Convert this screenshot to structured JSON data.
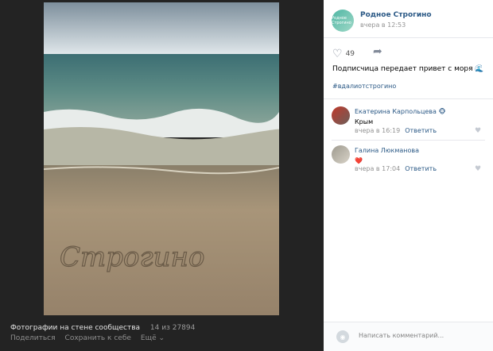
{
  "photo_viewer": {
    "caption": "Фотографии на стене сообщества",
    "counter": "14 из 27894",
    "actions": [
      "Поделиться",
      "Сохранить к себе",
      "Ещё"
    ]
  },
  "post": {
    "group_name": "Родное Строгино",
    "group_avatar_text": "Родное Строгино",
    "time": "вчера в 12:53",
    "likes": "49",
    "text": "Подписчица передает привет с моря 🌊",
    "hashtag": "#вдалиотстрогино",
    "photo_sand_text": "Строгино"
  },
  "comments": [
    {
      "name": "Екатерина Карпольцева 🐵",
      "text": "Крым",
      "time": "вчера в 16:19",
      "reply": "Ответить"
    },
    {
      "name": "Галина Люкманова",
      "text": "❤️",
      "time": "вчера в 17:04",
      "reply": "Ответить"
    }
  ],
  "composer": {
    "placeholder": "Написать комментарий..."
  },
  "colors": {
    "link": "#2a5885",
    "viewer_bg": "#232323"
  }
}
